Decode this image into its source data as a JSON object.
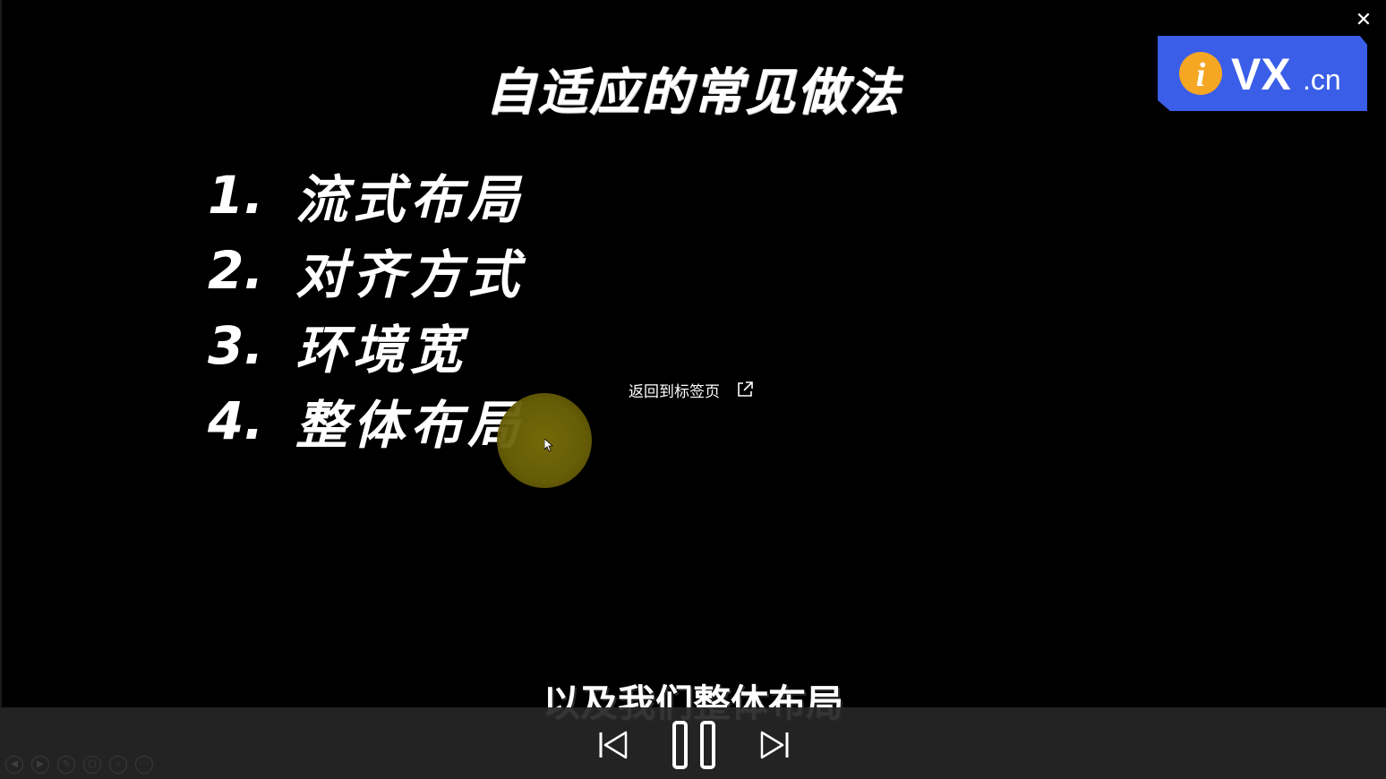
{
  "viewer": {
    "close_symbol": "✕"
  },
  "logo": {
    "letter": "i",
    "brand": "VX",
    "suffix": ".cn",
    "bg_color": "#3a5ee8",
    "accent_color": "#f5a623"
  },
  "slide": {
    "title": "自适应的常见做法",
    "items": [
      {
        "num": "1.",
        "text": "流式布局"
      },
      {
        "num": "2.",
        "text": "对齐方式"
      },
      {
        "num": "3.",
        "text": "环境宽"
      },
      {
        "num": "4.",
        "text": "整体布局"
      }
    ]
  },
  "overlay": {
    "return_label": "返回到标签页"
  },
  "subtitle": {
    "text": "以及我们整体布局"
  },
  "controls": {
    "prev_icon": "skip-previous-icon",
    "pause_icon": "pause-icon",
    "next_icon": "skip-next-icon"
  },
  "mini_toolbar": {
    "icons": [
      "prev-circle-icon",
      "next-circle-icon",
      "pen-icon",
      "screen-icon",
      "zoom-icon",
      "more-icon"
    ]
  },
  "colors": {
    "background": "#000000",
    "control_bar": "#262626",
    "pointer_halo": "#7a6e08"
  }
}
